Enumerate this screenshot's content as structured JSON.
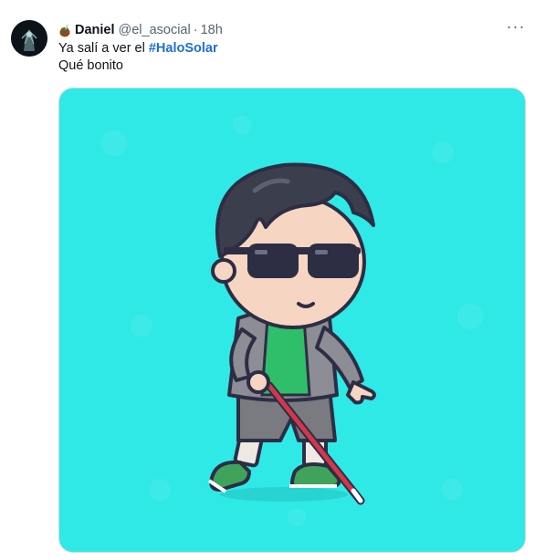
{
  "tweet": {
    "author": {
      "emoji_icon": "mate-gourd-icon",
      "display_name": "Daniel",
      "handle": "@el_asocial",
      "separator": "·",
      "time": "18h"
    },
    "more_label": "···",
    "text": {
      "line1_prefix": "Ya salí a ver el ",
      "hashtag": "#HaloSolar",
      "line2": "Qué bonito"
    },
    "media": {
      "description_icon": "cartoon-boy-sunglasses-cane-image"
    }
  },
  "colors": {
    "hashtag": "#1d6fd6",
    "handle": "#536471",
    "media_background": "#2fe9e7"
  }
}
